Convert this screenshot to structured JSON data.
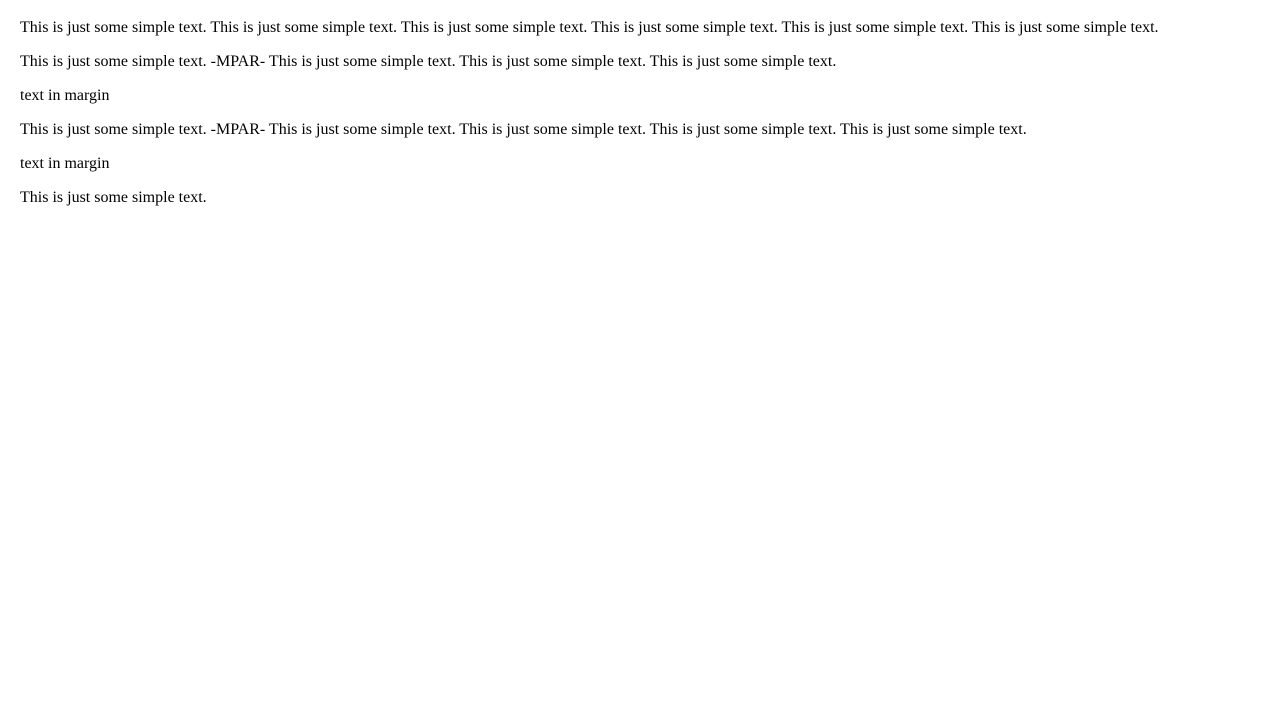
{
  "paragraphs": [
    "This is just some simple text. This is just some simple text. This is just some simple text. This is just some simple text. This is just some simple text. This is just some simple text.",
    "This is just some simple text. -MPAR- This is just some simple text. This is just some simple text. This is just some simple text.",
    "text in margin",
    "This is just some simple text. -MPAR- This is just some simple text. This is just some simple text. This is just some simple text. This is just some simple text.",
    "text in margin",
    "This is just some simple text."
  ]
}
